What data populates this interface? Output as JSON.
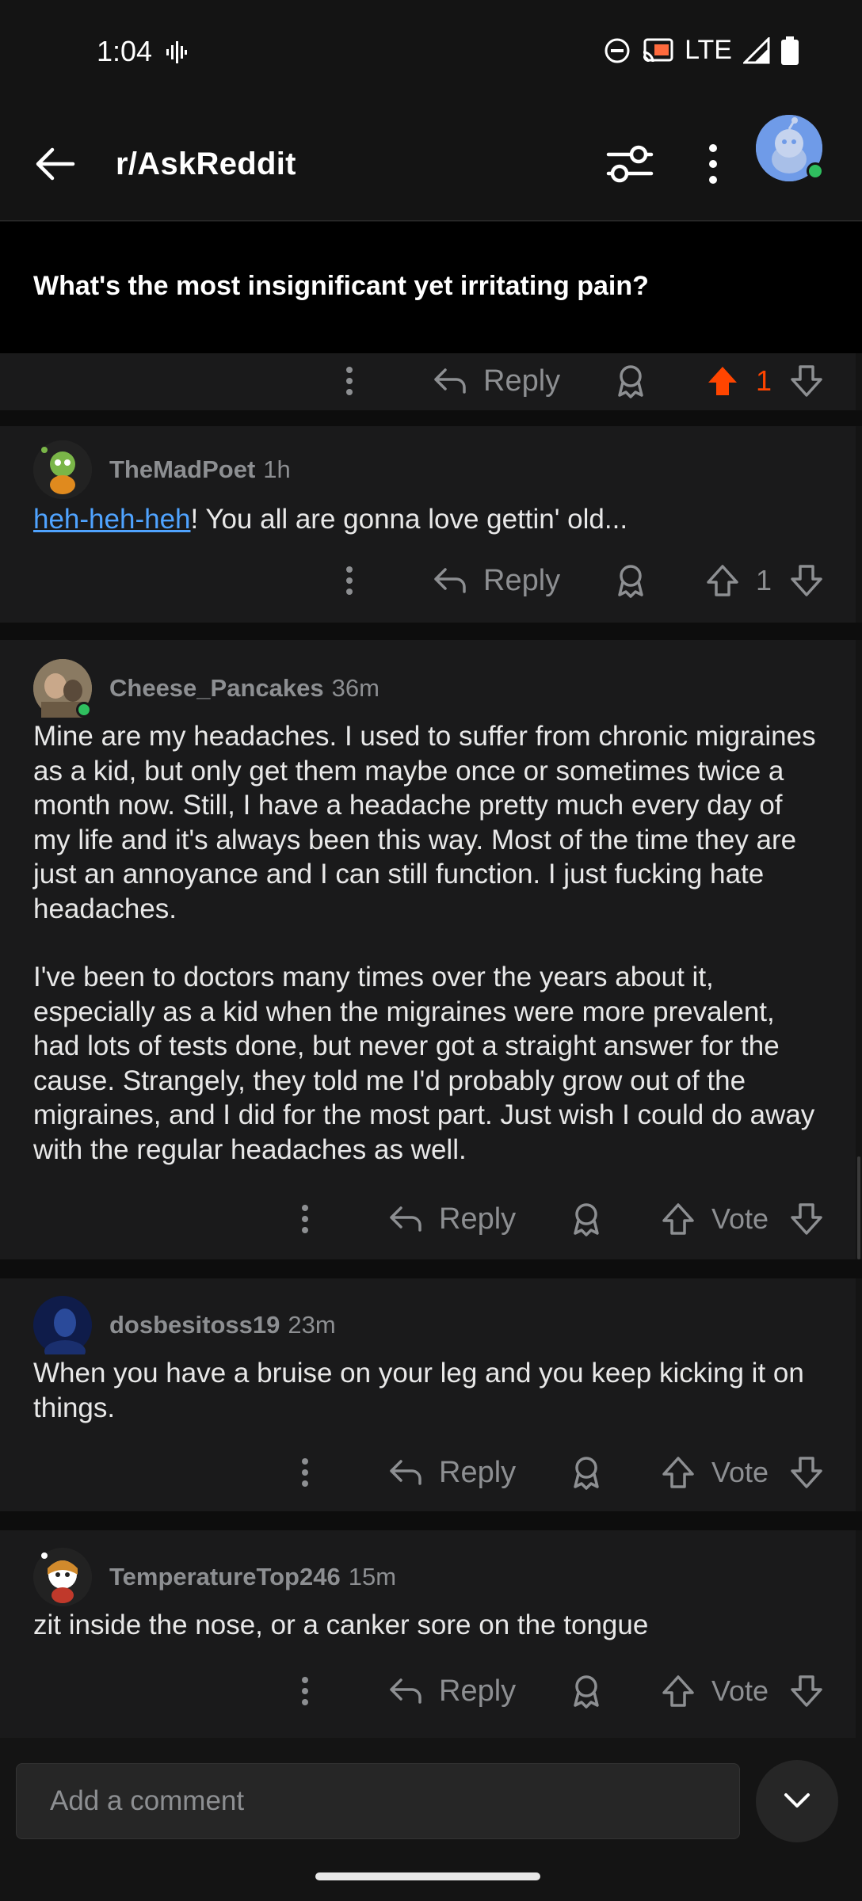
{
  "status_bar": {
    "time": "1:04",
    "network": "LTE"
  },
  "header": {
    "subreddit": "r/AskReddit"
  },
  "post": {
    "title": "What's the most insignificant yet irritating pain?"
  },
  "colors": {
    "upvote_active": "#ff4500",
    "link": "#4fa3ff",
    "online": "#2fbf5f"
  },
  "partial_comment": {
    "reply_label": "Reply",
    "votes": "1"
  },
  "comments": [
    {
      "author": "TheMadPoet",
      "age": "1h",
      "body_link": "heh-heh-heh",
      "body_rest": "! You all are gonna love gettin' old...",
      "reply_label": "Reply",
      "votes": "1"
    },
    {
      "author": "Cheese_Pancakes",
      "age": "36m",
      "paragraphs": [
        "Mine are my headaches.  I used to suffer from chronic migraines as a kid, but only get them maybe once or sometimes twice a month now.  Still, I have a headache pretty much every day of my life and it's always been this way.  Most of the time they are just an annoyance and I can still function.  I just fucking hate headaches.",
        "I've been to doctors many times over the years about it, especially as a kid when the migraines were more prevalent, had lots of tests done, but never got a straight answer for the cause.  Strangely, they told me I'd probably grow out of the migraines, and I did for the most part.  Just wish I could do away with the regular headaches as well."
      ],
      "reply_label": "Reply",
      "votes": "Vote"
    },
    {
      "author": "dosbesitoss19",
      "age": "23m",
      "body": "When you have a bruise on your leg and you keep kicking it on things.",
      "reply_label": "Reply",
      "votes": "Vote"
    },
    {
      "author": "TemperatureTop246",
      "age": "15m",
      "body": "zit inside the nose, or a canker sore on the tongue",
      "reply_label": "Reply",
      "votes": "Vote"
    }
  ],
  "composer": {
    "placeholder": "Add a comment"
  }
}
